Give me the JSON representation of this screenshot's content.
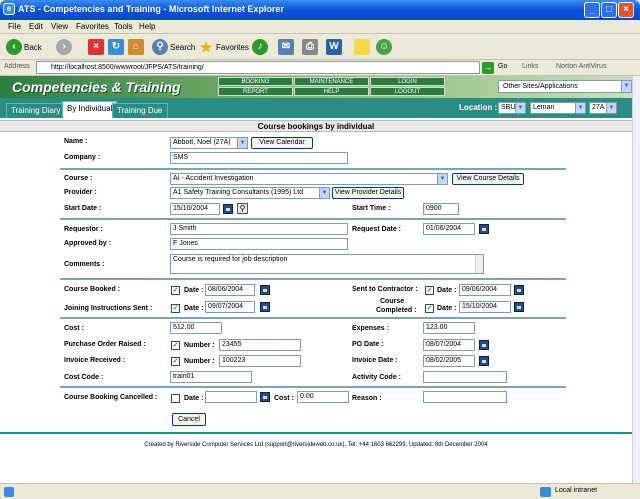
{
  "window": {
    "title": "ATS - Competencies and Training - Microsoft Internet Explorer",
    "ie_icon": "e"
  },
  "menu": [
    "File",
    "Edit",
    "View",
    "Favorites",
    "Tools",
    "Help"
  ],
  "toolbar": {
    "back": "Back",
    "search": "Search",
    "favorites": "Favorites"
  },
  "address": {
    "label": "Address",
    "url": "http://localhost:8500/wwwroot/JFPS/ATS/training/",
    "go": "Go",
    "links": "Links",
    "norton": "Norton AntiVirus"
  },
  "app": {
    "title": "Competencies & Training",
    "nav": {
      "booking": "BOOKING",
      "maintenance": "MAINTENANCE",
      "login": "LOGIN",
      "report": "REPORT",
      "help": "HELP",
      "logout": "LOGOUT"
    },
    "other_sites": "Other Sites/Applications",
    "tabs": [
      "Training Diary",
      "By Individual",
      "Training Due"
    ],
    "location_label": "Location :",
    "location": {
      "site": "SBU",
      "area": "Leman",
      "unit": "27A"
    },
    "page_header": "Course bookings by individual"
  },
  "form": {
    "name_label": "Name :",
    "name_value": "Abbott, Noel (27A)",
    "view_calendar": "View Calendar",
    "company_label": "Company :",
    "company_value": "SMS",
    "course_label": "Course :",
    "course_value": "AI - Accident Investigation",
    "view_course": "View Course Details",
    "provider_label": "Provider :",
    "provider_value": "A1 Safety Training Consultants (1995) Ltd",
    "view_provider": "View Provider Details",
    "start_date_label": "Start Date :",
    "start_date_value": "15/10/2004",
    "start_time_label": "Start Time :",
    "start_time_value": "0900",
    "requestor_label": "Requestor :",
    "requestor_value": "J Smith",
    "request_date_label": "Request Date :",
    "request_date_value": "01/06/2004",
    "approved_label": "Approved by :",
    "approved_value": "F Jones",
    "comments_label": "Comments :",
    "comments_value": "Course is required for job description",
    "course_booked_label": "Course Booked :",
    "date_label": "Date :",
    "course_booked_date": "08/06/2004",
    "sent_contractor_label": "Sent to Contractor :",
    "sent_contractor_date": "09/06/2004",
    "joining_label": "Joining Instructions Sent :",
    "joining_date": "09/07/2004",
    "completed_label_1": "Course",
    "completed_label_2": "Completed :",
    "completed_date": "15/10/2004",
    "cost_label": "Cost :",
    "cost_value": "512.00",
    "expenses_label": "Expenses :",
    "expenses_value": "123.00",
    "po_raised_label": "Purchase Order Raised :",
    "number_label": "Number :",
    "po_number": "23455",
    "po_date_label": "PO Date :",
    "po_date": "08/07/2004",
    "invoice_received_label": "Invoice Received :",
    "invoice_number": "100223",
    "invoice_date_label": "Invoice Date :",
    "invoice_date": "08/02/2005",
    "cost_code_label": "Cost Code :",
    "cost_code_value": "train01",
    "activity_code_label": "Activity Code :",
    "activity_code_value": "",
    "cancelled_label": "Course Booking Cancelled :",
    "cancel_cost_label": "Cost :",
    "cancel_cost_value": "0.00",
    "reason_label": "Reason :",
    "reason_value": "",
    "cancel_button": "Cancel",
    "check_mark": "✓"
  },
  "footer": "Created by Riverside Computer Services Ltd (support@riversideweb.co.uk), Tel: +44 1603 662299, Updated: 8th December 2004",
  "status": {
    "zone": "Local intranet"
  }
}
